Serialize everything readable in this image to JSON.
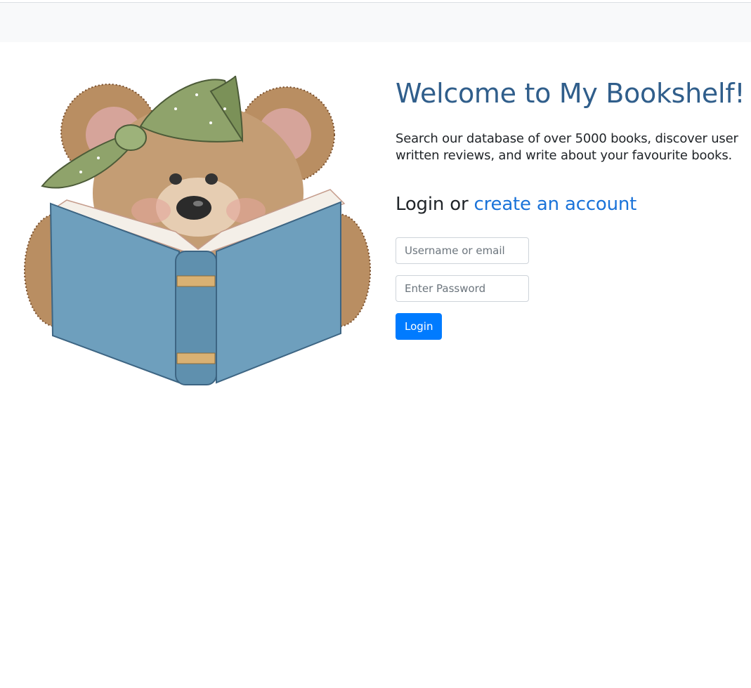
{
  "main": {
    "title": "Welcome to My Bookshelf!",
    "intro": "Search our database of over 5000 books, discover user written reviews, and write about your favourite books.",
    "login_prefix": "Login",
    "login_or": "or",
    "create_account_link": "create an account"
  },
  "form": {
    "username_placeholder": "Username or email",
    "password_placeholder": "Enter Password",
    "login_button": "Login"
  },
  "colors": {
    "title": "#305e8b",
    "link": "#1a73d9",
    "button": "#007bff",
    "navbar": "#f8f9fa"
  },
  "icons": {
    "illustration": "teddy-bear-reading-book"
  }
}
